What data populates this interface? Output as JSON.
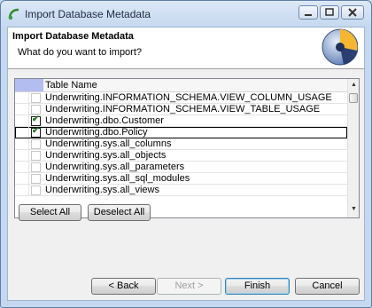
{
  "window": {
    "title": "Import Database Metadata"
  },
  "header": {
    "title": "Import Database Metadata",
    "subtitle": "What do you want to import?"
  },
  "table": {
    "column_header": "Table Name",
    "rows": [
      {
        "name": "Underwriting.INFORMATION_SCHEMA.VIEW_COLUMN_USAGE",
        "checked": false
      },
      {
        "name": "Underwriting.INFORMATION_SCHEMA.VIEW_TABLE_USAGE",
        "checked": false
      },
      {
        "name": "Underwriting.dbo.Customer",
        "checked": true
      },
      {
        "name": "Underwriting.dbo.Policy",
        "checked": true
      },
      {
        "name": "Underwriting.sys.all_columns",
        "checked": false
      },
      {
        "name": "Underwriting.sys.all_objects",
        "checked": false
      },
      {
        "name": "Underwriting.sys.all_parameters",
        "checked": false
      },
      {
        "name": "Underwriting.sys.all_sql_modules",
        "checked": false
      },
      {
        "name": "Underwriting.sys.all_views",
        "checked": false
      }
    ]
  },
  "buttons": {
    "select_all": "Select All",
    "deselect_all": "Deselect All",
    "back": "< Back",
    "next": "Next >",
    "finish": "Finish",
    "cancel": "Cancel"
  },
  "icons": {
    "app": "database-import-icon",
    "logo": "globe-logo-icon"
  }
}
